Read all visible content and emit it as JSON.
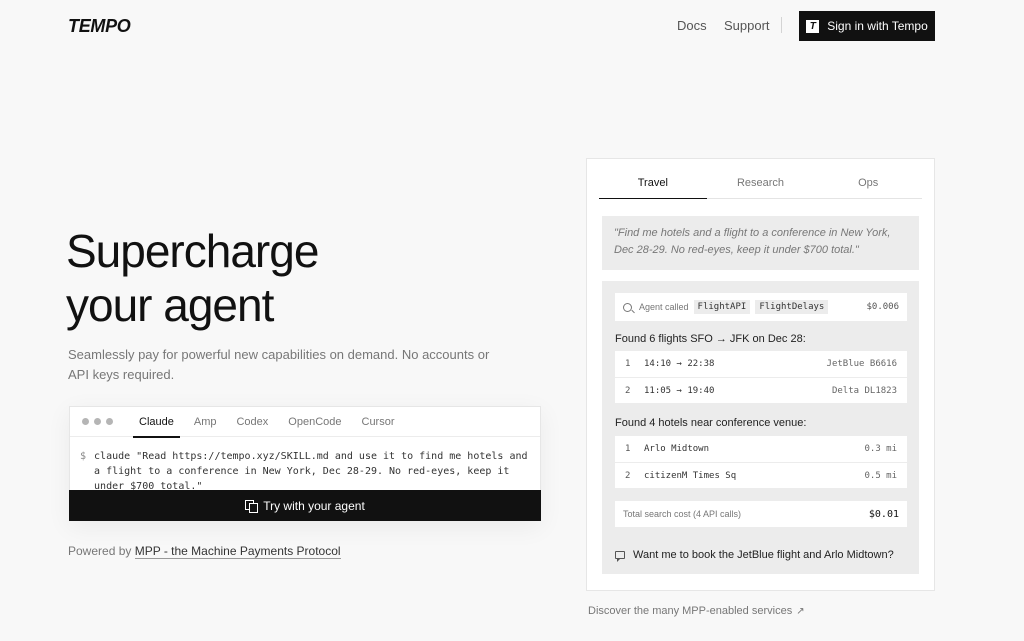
{
  "header": {
    "logo": "TEMPO",
    "nav": {
      "docs": "Docs",
      "support": "Support"
    },
    "signin": {
      "icon_letter": "T",
      "label": "Sign in with Tempo"
    }
  },
  "hero": {
    "title_line1": "Supercharge",
    "title_line2": "your agent",
    "subtitle": "Seamlessly pay for powerful new capabilities on demand. No accounts or API keys required."
  },
  "prompt_card": {
    "tabs": [
      "Claude",
      "Amp",
      "Codex",
      "OpenCode",
      "Cursor"
    ],
    "active_tab": "Claude",
    "prompt_symbol": "$",
    "command": "claude \"Read https://tempo.xyz/SKILL.md and use it to find me hotels and a flight to a conference in New York, Dec 28-29. No red-eyes, keep it under $700 total.\"",
    "button_label": "Try with your agent"
  },
  "powered": {
    "prefix": "Powered by ",
    "link": "MPP - the Machine Payments Protocol"
  },
  "panel": {
    "tabs": [
      "Travel",
      "Research",
      "Ops"
    ],
    "active_tab": "Travel",
    "quote": "\"Find me hotels and a flight to a conference in New York, Dec 28-29. No red-eyes, keep it under $700 total.\"",
    "called": {
      "label": "Agent called",
      "apis": [
        "FlightAPI",
        "FlightDelays"
      ],
      "cost": "$0.006"
    },
    "flights_label": "Found 6 flights SFO → JFK on Dec 28:",
    "flights": [
      {
        "idx": "1",
        "time": "14:10 → 22:38",
        "carrier": "JetBlue B6616"
      },
      {
        "idx": "2",
        "time": "11:05 → 19:40",
        "carrier": "Delta DL1823"
      }
    ],
    "hotels_label": "Found 4 hotels near conference venue:",
    "hotels": [
      {
        "idx": "1",
        "name": "Arlo Midtown",
        "distance": "0.3 mi"
      },
      {
        "idx": "2",
        "name": "citizenM Times Sq",
        "distance": "0.5 mi"
      }
    ],
    "total": {
      "label": "Total search cost (4 API calls)",
      "amount": "$0.01"
    },
    "followup": "Want me to book the JetBlue flight and Arlo Midtown?"
  },
  "discover": {
    "label": "Discover the many MPP-enabled services",
    "arrow": "↗"
  },
  "icons": [
    "copy-icon",
    "search-icon",
    "chat-icon",
    "external-arrow-icon",
    "tempo-logo-icon"
  ]
}
